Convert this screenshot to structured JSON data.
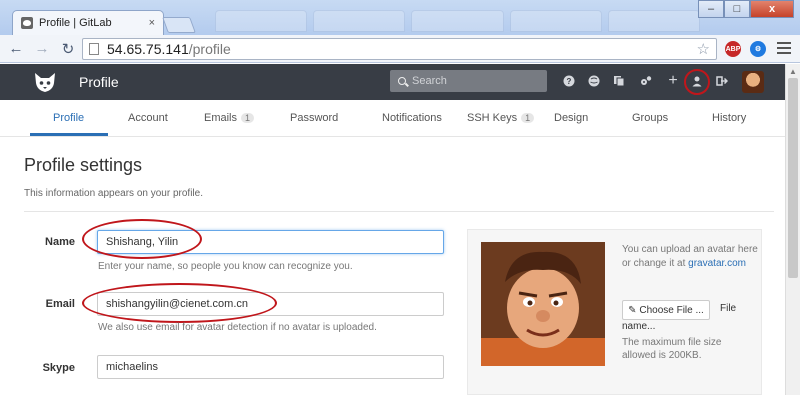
{
  "browser": {
    "tab_title": "Profile | GitLab",
    "tab_close": "×",
    "url_host": "54.65.75.141",
    "url_path": "/profile",
    "abp_label": "ABP",
    "window_buttons": [
      "–",
      "□",
      "x"
    ]
  },
  "header": {
    "title": "Profile",
    "search_placeholder": "Search",
    "icons": [
      "help-icon",
      "globe-icon",
      "copy-icon",
      "cogs-icon",
      "plus-icon",
      "user-icon",
      "sign-out-icon"
    ]
  },
  "subnav": {
    "items": [
      {
        "label": "Profile"
      },
      {
        "label": "Account"
      },
      {
        "label": "Emails",
        "badge": "1"
      },
      {
        "label": "Password"
      },
      {
        "label": "Notifications"
      },
      {
        "label": "SSH Keys",
        "badge": "1"
      },
      {
        "label": "Design"
      },
      {
        "label": "Groups"
      },
      {
        "label": "History"
      }
    ]
  },
  "page": {
    "heading": "Profile settings",
    "subheading": "This information appears on your profile."
  },
  "form": {
    "name": {
      "label": "Name",
      "value": "Shishang, Yilin",
      "help": "Enter your name, so people you know can recognize you."
    },
    "email": {
      "label": "Email",
      "value": "shishangyilin@cienet.com.cn",
      "help": "We also use email for avatar detection if no avatar is uploaded."
    },
    "skype": {
      "label": "Skype",
      "value": "michaelins"
    }
  },
  "avatar": {
    "upload_text": "You can upload an avatar here",
    "change_prefix": "or change it at ",
    "gravatar_link": "gravatar.com",
    "choose_file_button": "Choose File ...",
    "file_label": "File",
    "file_name": "name...",
    "max_size_note": "The maximum file size allowed is 200KB."
  },
  "colors": {
    "header_bg": "#383d45",
    "accent": "#2b6fb5",
    "annotation_red": "#c0161b"
  }
}
